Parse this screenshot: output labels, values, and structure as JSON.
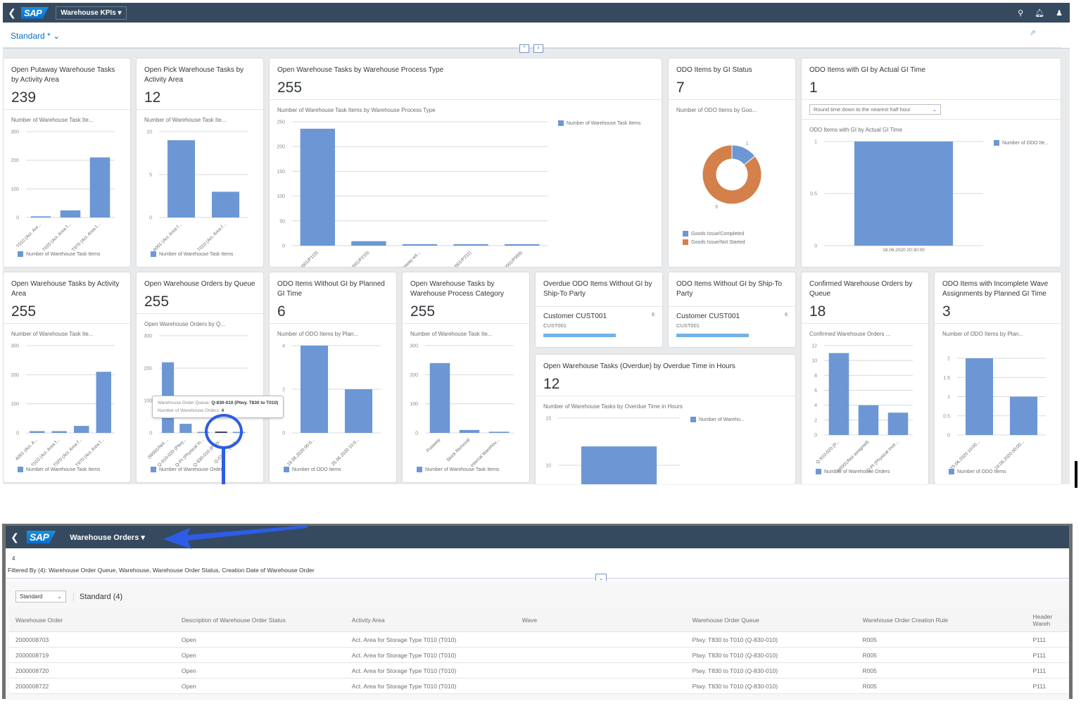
{
  "shell": {
    "back_icon": "chevron-left-icon",
    "logo": "SAP",
    "app_title": "Warehouse KPIs ▾",
    "icons": [
      "search-icon",
      "bell-icon",
      "user-icon"
    ]
  },
  "variant": {
    "label": "Standard *",
    "chevron": "⌵",
    "share_icon": "share-icon"
  },
  "collapse": {
    "up": "^",
    "pin": "⌄"
  },
  "cards": [
    {
      "id": "putaway",
      "title": "Open Putaway Warehouse Tasks by Activity Area",
      "kpi": "239",
      "subtitle": "Number of Warehouse Task Ite...",
      "legend": "Number of Warehouse Task Items"
    },
    {
      "id": "pick",
      "title": "Open Pick Warehouse Tasks by Activity Area",
      "kpi": "12",
      "subtitle": "Number of Warehouse Task Ite...",
      "legend": "Number of Warehouse Task Items"
    },
    {
      "id": "proctype",
      "title": "Open Warehouse Tasks by Warehouse Process Type",
      "kpi": "255",
      "subtitle": "Number of Warehouse Task Items by Warehouse Process Type",
      "legend": "Number of Warehouse Task Items"
    },
    {
      "id": "gistatus",
      "title": "ODO Items by GI Status",
      "kpi": "7",
      "subtitle": "Number of ODO Items by Goo...",
      "legend1": "Goods Issue/Completed",
      "legend2": "Goods Issue/Not Started"
    },
    {
      "id": "actualgi",
      "title": "ODO Items with GI by Actual GI Time",
      "kpi": "1",
      "select": "Round time down to the nearest half hour",
      "subtitle": "ODO Items with GI by Actual GI Time",
      "legend": "Number of ODO Ite..."
    },
    {
      "id": "actarea",
      "title": "Open Warehouse Tasks by Activity Area",
      "kpi": "255",
      "subtitle": "Number of Warehouse Task Ite...",
      "legend": "Number of Warehouse Task Items"
    },
    {
      "id": "queue",
      "title": "Open Warehouse Orders by Queue",
      "kpi": "255",
      "subtitle": "Open Warehouse Orders by Q...",
      "legend": "Number of Warehouse Orders"
    },
    {
      "id": "plannedgi",
      "title": "ODO Items Without GI by Planned GI Time",
      "kpi": "6",
      "subtitle": "Number of ODO Items by Plan...",
      "legend": "Number of ODO Items"
    },
    {
      "id": "proccat",
      "title": "Open Warehouse Tasks by Warehouse Process Category",
      "kpi": "255",
      "subtitle": "Number of Warehouse Task Ite...",
      "legend": "Number of Warehouse Task Items"
    },
    {
      "id": "overdue_ship",
      "title": "Overdue ODO Items Without GI by Ship-To Party",
      "item_name": "Customer CUST001",
      "item_id": "CUST001",
      "item_value": "6"
    },
    {
      "id": "ship",
      "title": "ODO Items Without GI by Ship-To Party",
      "item_name": "Customer CUST001",
      "item_id": "CUST001",
      "item_value": "6"
    },
    {
      "id": "overdue_hours",
      "title": "Open Warehouse Tasks (Overdue) by Overdue Time in Hours",
      "kpi": "12",
      "subtitle": "Number of Warehouse Tasks by Overdue Time in Hours",
      "legend": "Number of Wareho..."
    },
    {
      "id": "confqueue",
      "title": "Confirmed Warehouse Orders by Queue",
      "kpi": "18",
      "subtitle": "Confirmed Warehouse Orders ...",
      "legend": "Number of Warehouse Orders"
    },
    {
      "id": "wave",
      "title": "ODO Items with Incomplete Wave Assignments by Planned GI Time",
      "kpi": "3",
      "subtitle": "Number of ODO Items by Plan...",
      "legend": "Number of ODO Items"
    }
  ],
  "tooltip": {
    "label1": "Warehouse Order Queue: ",
    "value1": "Q-830-010 (Ptwy. T830 to T010)",
    "label2": "Number of Warehouse Orders: ",
    "value2": "4"
  },
  "chart_data": [
    {
      "id": "putaway",
      "type": "bar",
      "categories": [
        "T010 (Act. Are...",
        "T020 (Act. Area f...",
        "T970 (Act. Area f..."
      ],
      "values": [
        4,
        25,
        210
      ],
      "yticks": [
        0,
        100,
        200,
        300
      ],
      "ylim": [
        0,
        300
      ]
    },
    {
      "id": "pick",
      "type": "bar",
      "categories": [
        "A001 (Act. Area f...",
        "T010 (Act. Area f..."
      ],
      "values": [
        9,
        3
      ],
      "yticks": [
        0,
        5,
        10
      ],
      "ylim": [
        0,
        10
      ]
    },
    {
      "id": "proctype",
      "type": "bar",
      "categories": [
        "P110 (W001/P110)",
        "P210 (W001/P210)",
        "P111 (Putaway wit...",
        "P211 (W001/P211)",
        "P999 (W001/P999)"
      ],
      "values": [
        236,
        9,
        3,
        3,
        3
      ],
      "yticks": [
        0,
        50,
        100,
        150,
        200,
        250
      ],
      "ylim": [
        0,
        250
      ]
    },
    {
      "id": "gistatus",
      "type": "pie",
      "categories": [
        "Goods Issue/Completed",
        "Goods Issue/Not Started"
      ],
      "values": [
        1,
        6
      ],
      "colors": [
        "#6c97d4",
        "#d4804a"
      ]
    },
    {
      "id": "actualgi",
      "type": "bar",
      "categories": [
        "18.06.2020 20:30:00"
      ],
      "values": [
        1
      ],
      "yticks": [
        0,
        0.5,
        1
      ],
      "ylim": [
        0,
        1
      ]
    },
    {
      "id": "actarea",
      "type": "bar",
      "categories": [
        "A001 (Act. A...",
        "T010 (Act. Area f...",
        "T020 (Act. Area f...",
        "T970 (Act. Area f..."
      ],
      "values": [
        6,
        6,
        24,
        210
      ],
      "yticks": [
        0,
        100,
        200,
        300
      ],
      "ylim": [
        0,
        300
      ]
    },
    {
      "id": "queue",
      "type": "bar",
      "categories": [
        "(W001/Not ...",
        "Q-910-020 (Ptwy...",
        "Q-PI (Physical In...",
        "Q-830-010 (Ptwy...",
        "Q-010-... (Pick..."
      ],
      "values": [
        218,
        28,
        3,
        4,
        3
      ],
      "yticks": [
        0,
        100,
        200,
        300
      ],
      "ylim": [
        0,
        300
      ],
      "highlight": 3
    },
    {
      "id": "plannedgi",
      "type": "bar",
      "categories": [
        "18.06.2020 00:0...",
        "25.06.2020 10:0..."
      ],
      "values": [
        4,
        2
      ],
      "yticks": [
        0,
        2,
        4
      ],
      "ylim": [
        0,
        4
      ]
    },
    {
      "id": "proccat",
      "type": "bar",
      "categories": [
        "Putaway",
        "Stock Removal",
        "Internal Warehou..."
      ],
      "values": [
        240,
        10,
        4
      ],
      "yticks": [
        0,
        100,
        200,
        300
      ],
      "ylim": [
        0,
        300
      ]
    },
    {
      "id": "overdue_hours",
      "type": "bar",
      "categories": [
        ""
      ],
      "values": [
        12
      ],
      "yticks": [
        10,
        15
      ],
      "ylim": [
        5,
        15
      ]
    },
    {
      "id": "confqueue",
      "type": "bar",
      "categories": [
        "Q-910-020 (P...",
        "(W001/Not assigned)",
        "Q-PI (Physical Inve..."
      ],
      "values": [
        11,
        4,
        3
      ],
      "yticks": [
        0,
        2,
        4,
        6,
        8,
        10,
        12
      ],
      "ylim": [
        0,
        12
      ]
    },
    {
      "id": "wave",
      "type": "bar",
      "categories": [
        "25.06.2020 10:00...",
        "18.06.2020 00:00..."
      ],
      "values": [
        2,
        1
      ],
      "yticks": [
        0,
        0.5,
        1,
        1.5,
        2
      ],
      "ylim": [
        0,
        2
      ]
    }
  ],
  "orders": {
    "shell_title": "Warehouse Orders ▾",
    "count": "4",
    "filter_text": "Filtered By (4): Warehouse Order Queue, Warehouse, Warehouse Order Status, Creation Date of Warehouse Order",
    "variant_select": "Standard",
    "table_title": "Standard (4)",
    "columns": [
      "Warehouse Order",
      "Description of Warehouse Order Status",
      "Activity Area",
      "Wave",
      "Warehouse Order Queue",
      "Warehouse Order Creation Rule",
      "Header Wareh"
    ],
    "rows": [
      [
        "2000008703",
        "Open",
        "Act. Area for Storage Type T010 (T010)",
        "",
        "Ptwy. T830 to T010 (Q-830-010)",
        "R005",
        "P111"
      ],
      [
        "2000008719",
        "Open",
        "Act. Area for Storage Type T010 (T010)",
        "",
        "Ptwy. T830 to T010 (Q-830-010)",
        "R005",
        "P111"
      ],
      [
        "2000008720",
        "Open",
        "Act. Area for Storage Type T010 (T010)",
        "",
        "Ptwy. T830 to T010 (Q-830-010)",
        "R005",
        "P111"
      ],
      [
        "2000008722",
        "Open",
        "Act. Area for Storage Type T010 (T010)",
        "",
        "Ptwy. T830 to T010 (Q-830-010)",
        "R005",
        "P111"
      ]
    ]
  },
  "colors": {
    "shell": "#354a5f",
    "bar": "#6c97d4",
    "accent": "#0a6ed1",
    "annotation": "#2d5ce6"
  }
}
